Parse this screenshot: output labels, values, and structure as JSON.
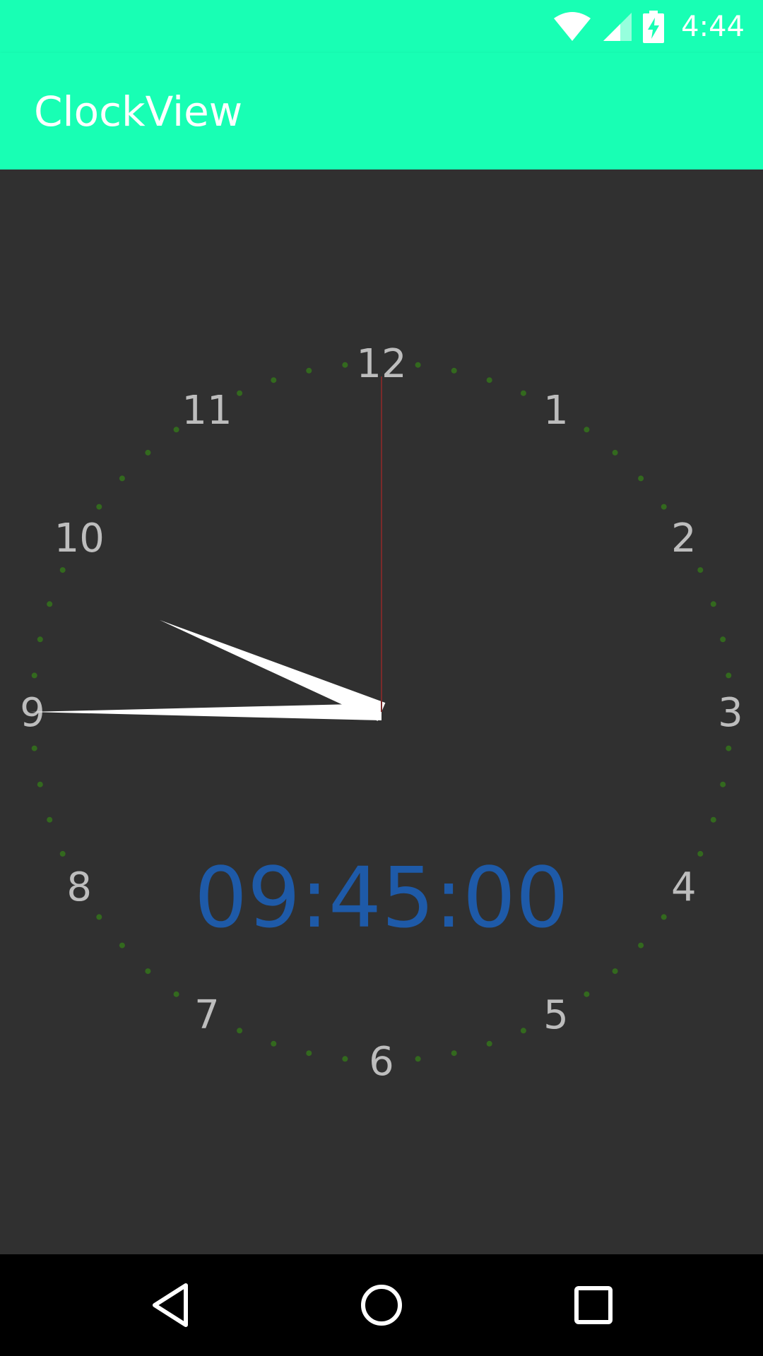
{
  "status_bar": {
    "time": "4:44",
    "icons": [
      "wifi-icon",
      "cellular-signal-icon",
      "battery-charging-icon"
    ]
  },
  "app_bar": {
    "title": "ClockView",
    "color": "#18FFB4"
  },
  "clock": {
    "numerals": [
      "12",
      "1",
      "2",
      "3",
      "4",
      "5",
      "6",
      "7",
      "8",
      "9",
      "10",
      "11"
    ],
    "digital_time": "09:45:00",
    "hours": 9,
    "minutes": 45,
    "seconds": 0,
    "colors": {
      "background": "#303030",
      "numeral": "#BDBDBD",
      "tick_dot": "#33691E",
      "hand": "#FFFFFF",
      "second_hand": "#7A2A2A",
      "digital_text": "#1E5AA8"
    }
  },
  "nav_bar": {
    "buttons": [
      "back-icon",
      "home-icon",
      "recents-icon"
    ]
  }
}
